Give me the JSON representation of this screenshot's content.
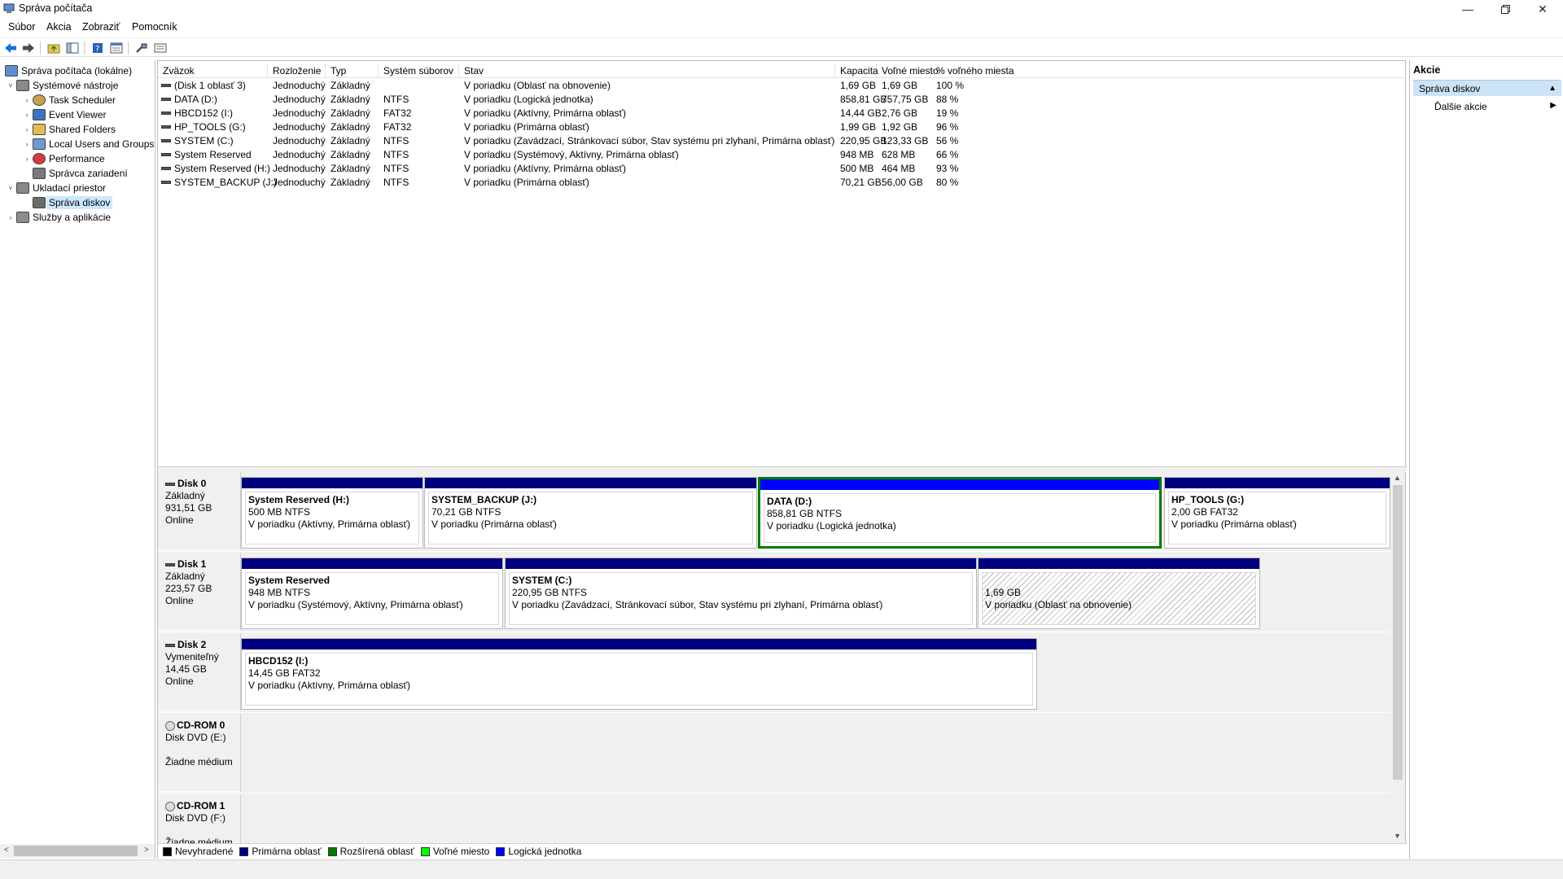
{
  "window": {
    "title": "Správa počítača"
  },
  "menu": [
    "Súbor",
    "Akcia",
    "Zobraziť",
    "Pomocník"
  ],
  "tree": [
    {
      "label": "Správa počítača (lokálne)",
      "level": 0,
      "expander": "",
      "icon": "computer-management-icon"
    },
    {
      "label": "Systémové nástroje",
      "level": 1,
      "expander": "v",
      "icon": "tools-icon"
    },
    {
      "label": "Task Scheduler",
      "level": 2,
      "expander": ">",
      "icon": "clock-icon"
    },
    {
      "label": "Event Viewer",
      "level": 2,
      "expander": ">",
      "icon": "event-viewer-icon"
    },
    {
      "label": "Shared Folders",
      "level": 2,
      "expander": ">",
      "icon": "shared-folder-icon"
    },
    {
      "label": "Local Users and Groups",
      "level": 2,
      "expander": ">",
      "icon": "users-icon"
    },
    {
      "label": "Performance",
      "level": 2,
      "expander": ">",
      "icon": "performance-icon"
    },
    {
      "label": "Správca zariadení",
      "level": 2,
      "expander": "",
      "icon": "device-manager-icon"
    },
    {
      "label": "Ukladací priestor",
      "level": 1,
      "expander": "v",
      "icon": "storage-icon"
    },
    {
      "label": "Správa diskov",
      "level": 2,
      "expander": "",
      "icon": "disk-management-icon",
      "selected": true
    },
    {
      "label": "Služby a aplikácie",
      "level": 1,
      "expander": ">",
      "icon": "services-icon"
    }
  ],
  "columns": [
    "Zväzok",
    "Rozloženie",
    "Typ",
    "Systém súborov",
    "Stav",
    "Kapacita",
    "Voľné miesto",
    "% voľného miesta"
  ],
  "volumes": [
    [
      "(Disk 1 oblasť 3)",
      "Jednoduchý",
      "Základný",
      "",
      "V poriadku (Oblasť na obnovenie)",
      "1,69 GB",
      "1,69 GB",
      "100 %"
    ],
    [
      "DATA (D:)",
      "Jednoduchý",
      "Základný",
      "NTFS",
      "V poriadku (Logická jednotka)",
      "858,81 GB",
      "757,75 GB",
      "88 %"
    ],
    [
      "HBCD152 (I:)",
      "Jednoduchý",
      "Základný",
      "FAT32",
      "V poriadku (Aktívny, Primárna oblasť)",
      "14,44 GB",
      "2,76 GB",
      "19 %"
    ],
    [
      "HP_TOOLS (G:)",
      "Jednoduchý",
      "Základný",
      "FAT32",
      "V poriadku (Primárna oblasť)",
      "1,99 GB",
      "1,92 GB",
      "96 %"
    ],
    [
      "SYSTEM (C:)",
      "Jednoduchý",
      "Základný",
      "NTFS",
      "V poriadku (Zavádzací, Stránkovací súbor, Stav systému pri zlyhaní, Primárna oblasť)",
      "220,95 GB",
      "123,33 GB",
      "56 %"
    ],
    [
      "System Reserved",
      "Jednoduchý",
      "Základný",
      "NTFS",
      "V poriadku (Systémový, Aktívny, Primárna oblasť)",
      "948 MB",
      "628 MB",
      "66 %"
    ],
    [
      "System Reserved (H:)",
      "Jednoduchý",
      "Základný",
      "NTFS",
      "V poriadku (Aktívny, Primárna oblasť)",
      "500 MB",
      "464 MB",
      "93 %"
    ],
    [
      "SYSTEM_BACKUP (J:)",
      "Jednoduchý",
      "Základný",
      "NTFS",
      "V poriadku (Primárna oblasť)",
      "70,21 GB",
      "56,00 GB",
      "80 %"
    ]
  ],
  "disks": [
    {
      "name": "Disk 0",
      "type": "Základný",
      "size": "931,51 GB",
      "status": "Online",
      "icon": "disk",
      "partitions": [
        {
          "name": "System Reserved  (H:)",
          "size": "500 MB NTFS",
          "status": "V poriadku (Aktívny, Primárna oblasť)",
          "kind": "primary"
        },
        {
          "name": "SYSTEM_BACKUP  (J:)",
          "size": "70,21 GB NTFS",
          "status": "V poriadku (Primárna oblasť)",
          "kind": "primary"
        },
        {
          "name": "DATA  (D:)",
          "size": "858,81 GB NTFS",
          "status": "V poriadku (Logická jednotka)",
          "kind": "logical",
          "selected": true
        },
        {
          "name": "HP_TOOLS  (G:)",
          "size": "2,00 GB FAT32",
          "status": "V poriadku (Primárna oblasť)",
          "kind": "primary"
        }
      ]
    },
    {
      "name": "Disk 1",
      "type": "Základný",
      "size": "223,57 GB",
      "status": "Online",
      "icon": "disk",
      "partitions": [
        {
          "name": "System Reserved",
          "size": "948 MB NTFS",
          "status": "V poriadku (Systémový, Aktívny, Primárna oblasť)",
          "kind": "primary"
        },
        {
          "name": "SYSTEM  (C:)",
          "size": "220,95 GB NTFS",
          "status": "V poriadku (Zavádzací, Stránkovací súbor, Stav systému pri zlyhaní, Primárna oblasť)",
          "kind": "primary"
        },
        {
          "name": "",
          "size": "1,69 GB",
          "status": "V poriadku (Oblasť na obnovenie)",
          "kind": "recovery"
        }
      ]
    },
    {
      "name": "Disk 2",
      "type": "Vymeniteľný",
      "size": "14,45 GB",
      "status": "Online",
      "icon": "disk",
      "partitions": [
        {
          "name": "HBCD152  (I:)",
          "size": "14,45 GB FAT32",
          "status": "V poriadku (Aktívny, Primárna oblasť)",
          "kind": "primary"
        }
      ]
    },
    {
      "name": "CD-ROM 0",
      "type": "Disk DVD (E:)",
      "size": "",
      "status": "Žiadne médium",
      "icon": "cd",
      "partitions": []
    },
    {
      "name": "CD-ROM 1",
      "type": "Disk DVD (F:)",
      "size": "",
      "status": "Žiadne médium",
      "icon": "cd",
      "partitions": []
    }
  ],
  "legend": [
    {
      "label": "Nevyhradené",
      "color": "#000000"
    },
    {
      "label": "Primárna oblasť",
      "color": "#00007f"
    },
    {
      "label": "Rozšírená oblasť",
      "color": "#007c00"
    },
    {
      "label": "Voľné miesto",
      "color": "#00ff00"
    },
    {
      "label": "Logická jednotka",
      "color": "#0000ff"
    }
  ],
  "actions": {
    "header": "Akcie",
    "section": "Správa diskov",
    "more": "Ďalšie akcie"
  }
}
